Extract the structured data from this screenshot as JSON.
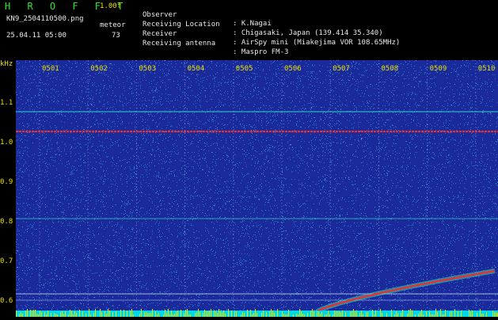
{
  "header": {
    "title": "H R O F F T",
    "version": "1.00f",
    "file_name": "KN9_2504110500.png",
    "meteor_label": "meteor",
    "timestamp": "25.04.11 05:00",
    "meteor_count": "73",
    "info": [
      {
        "key": "Observer",
        "value": ": K.Nagai"
      },
      {
        "key": "Receiving Location",
        "value": ": Chigasaki, Japan (139.414 35.340)"
      },
      {
        "key": "Receiver",
        "value": ": AirSpy mini (Miakejima VOR 108.65MHz)"
      },
      {
        "key": "Receiving antenna",
        "value": ": Maspro FM-3"
      }
    ]
  },
  "spectrogram": {
    "y_unit": "kHz",
    "y_ticks": [
      "1.1",
      "1.0",
      "0.9",
      "0.8",
      "0.7",
      "0.6"
    ],
    "time_labels": [
      "0501",
      "0502",
      "0503",
      "0504",
      "0505",
      "0506",
      "0507",
      "0508",
      "0509",
      "0510"
    ],
    "colors": {
      "background": "#1a2a9a",
      "noise": "#2f8ad8",
      "carrier": "#30d8d0",
      "signal": "#e83030",
      "bottom_strip": "#e8e800"
    }
  }
}
